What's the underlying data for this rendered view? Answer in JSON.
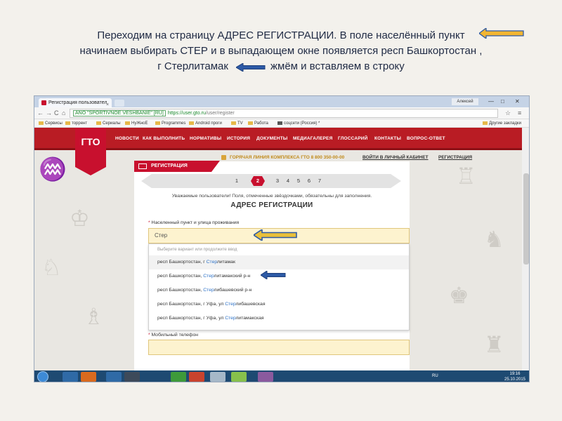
{
  "caption": {
    "line1": "Переходим на страницу АДРЕС РЕГИСТРАЦИИ.  В поле населённый пункт",
    "line2": "начинаем выбирать СТЕР и в выпадающем окне появляется респ Башкортостан ,",
    "line3a": "г Стерлитамак",
    "line3b": "жмём и вставляем в строку"
  },
  "colors": {
    "arrow_gold": "#f2b632",
    "arrow_blue": "#2d5aa6",
    "brand_red": "#c8102e"
  },
  "browser": {
    "tab_title": "Регистрация пользовател",
    "tab_close": "×",
    "user_chip": "Алексей",
    "win_min": "—",
    "win_max": "□",
    "win_close": "✕",
    "nav_back": "←",
    "nav_forward": "→",
    "nav_reload": "C",
    "nav_home": "⌂",
    "security_label": "ANO \"SPORTIVNOE VESHBANIE\" [RU]",
    "url_host": "https://user.gto.ru",
    "url_path": "/user/register",
    "star": "☆",
    "menu": "≡",
    "bookmarks": [
      {
        "label": "Сервисы"
      },
      {
        "label": "торрент"
      },
      {
        "label": "Сериалы"
      },
      {
        "label": "НуЖноЕ"
      },
      {
        "label": "Programmes"
      },
      {
        "label": "Android проги"
      },
      {
        "label": "TV"
      },
      {
        "label": "Работа"
      },
      {
        "label": "соцсети (Россия) *"
      }
    ],
    "other_bookmarks": "Другие закладки"
  },
  "site": {
    "logo": "ГТО",
    "nav": [
      "НОВОСТИ",
      "КАК ВЫПОЛНИТЬ",
      "НОРМАТИВЫ",
      "ИСТОРИЯ",
      "ДОКУМЕНТЫ",
      "МЕДИАГАЛЕРЕЯ",
      "ГЛОССАРИЙ",
      "КОНТАКТЫ",
      "ВОПРОС-ОТВЕТ"
    ],
    "hotline": "ГОРЯЧАЯ ЛИНИЯ КОМПЛЕКСА ГТО 8 800 350-00-00",
    "cabinet": "ВОЙТИ В ЛИЧНЫЙ КАБИНЕТ",
    "register_link": "РЕГИСТРАЦИЯ",
    "section_badge": "РЕГИСТРАЦИЯ",
    "steps": [
      "1",
      "2",
      "3",
      "4",
      "5",
      "6",
      "7"
    ],
    "current_step": 2,
    "notice": "Уважаемые пользователи! Поля, отмеченные звёздочками, обязательны для заполнения.",
    "section_title": "АДРЕС РЕГИСТРАЦИИ",
    "required_mark": "*",
    "field_label": "Населенный пункт и улица проживания",
    "field_value": "Стер",
    "dropdown_hint": "Выберите вариант или продолжите ввод",
    "suggestions": [
      {
        "pre": "респ Башкортостан, г ",
        "match": "Стер",
        "post": "литамак"
      },
      {
        "pre": "респ Башкортостан, ",
        "match": "Стер",
        "post": "литамакский р-н"
      },
      {
        "pre": "респ Башкортостан, ",
        "match": "Стер",
        "post": "либашевский р-н"
      },
      {
        "pre": "респ Башкортостан, г Уфа, ул ",
        "match": "Стер",
        "post": "либашевская"
      },
      {
        "pre": "респ Башкортостан, г Уфа, ул ",
        "match": "Стер",
        "post": "литамакская"
      }
    ],
    "phone_label": "Мобильный телефон"
  },
  "taskbar": {
    "lang": "RU",
    "time": "19:16",
    "date": "25.10.2015"
  }
}
